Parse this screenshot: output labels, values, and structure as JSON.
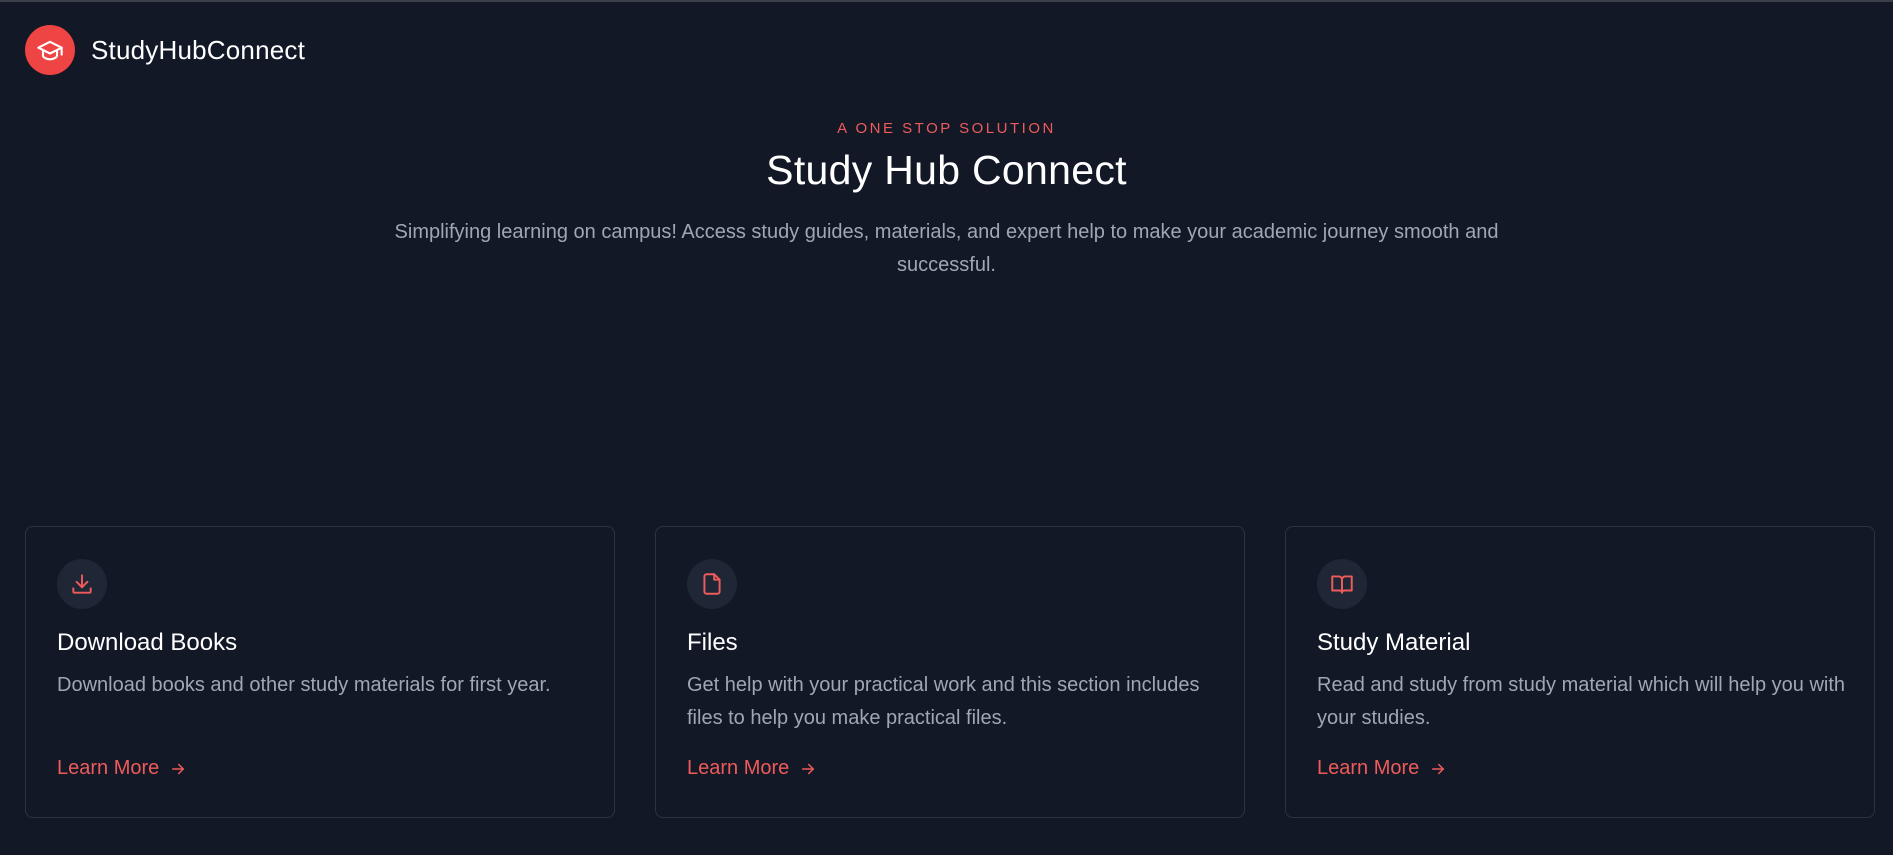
{
  "header": {
    "brand_name": "StudyHubConnect",
    "logo_icon": "graduation-cap-icon",
    "accent_color": "#ef4444"
  },
  "hero": {
    "eyebrow": "A ONE STOP SOLUTION",
    "title": "Study Hub Connect",
    "subtitle": "Simplifying learning on campus! Access study guides, materials, and expert help to make your academic journey smooth and successful."
  },
  "cards": [
    {
      "icon": "download-icon",
      "title": "Download Books",
      "description": "Download books and other study materials for first year.",
      "link_label": "Learn More"
    },
    {
      "icon": "file-icon",
      "title": "Files",
      "description": "Get help with your practical work and this section includes files to help you make practical files.",
      "link_label": "Learn More"
    },
    {
      "icon": "book-open-icon",
      "title": "Study Material",
      "description": "Read and study from study material which will help you with your studies.",
      "link_label": "Learn More"
    }
  ]
}
